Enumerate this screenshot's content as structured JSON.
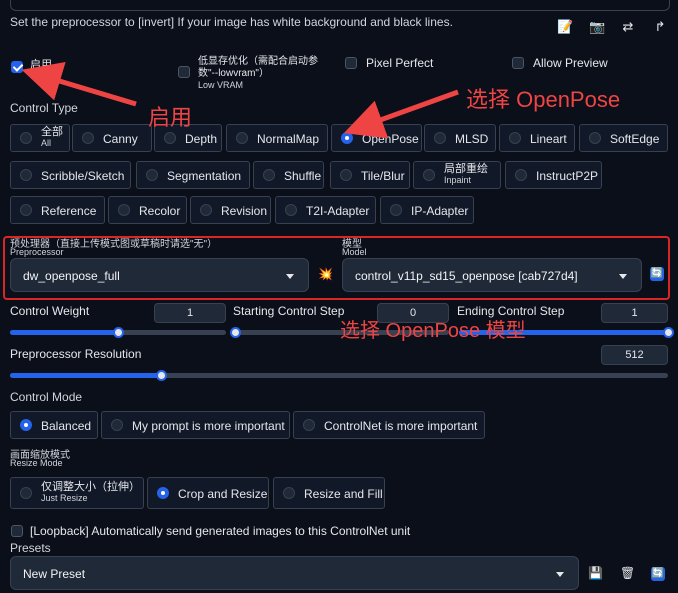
{
  "note": "Set the preprocessor to [invert] If your image has white background and black lines.",
  "toolbar_icons": [
    "edit-icon",
    "camera-icon",
    "swap-icon",
    "send-icon"
  ],
  "toolbar_glyphs": [
    "📝",
    "📷",
    "⇄",
    "↱"
  ],
  "options": {
    "enable_zh": "启用",
    "enable_en": "Enable",
    "enable_checked": true,
    "lowvram_zh": "低显存优化（需配合启动参数\"--lowvram\"）",
    "lowvram_en": "Low VRAM",
    "lowvram_checked": false,
    "pixel_perfect": "Pixel Perfect",
    "pixel_perfect_checked": false,
    "allow_preview": "Allow Preview",
    "allow_preview_checked": false
  },
  "control_type": {
    "label": "Control Type",
    "items": [
      "全部",
      "Canny",
      "Depth",
      "NormalMap",
      "OpenPose",
      "MLSD",
      "Lineart",
      "SoftEdge",
      "Scribble/Sketch",
      "Segmentation",
      "Shuffle",
      "Tile/Blur",
      "局部重绘",
      "InstructP2P",
      "Reference",
      "Recolor",
      "Revision",
      "T2I-Adapter",
      "IP-Adapter"
    ],
    "all_sub": "All",
    "inpaint_sub": "Inpaint",
    "selected": "OpenPose"
  },
  "preprocessor": {
    "label_zh": "预处理器（直接上传模式图或草稿时请选\"无\"）",
    "label_en": "Preprocessor",
    "value": "dw_openpose_full"
  },
  "explode_glyph": "💥",
  "model": {
    "label_zh": "模型",
    "label_en": "Model",
    "value": "control_v11p_sd15_openpose [cab727d4]"
  },
  "refresh_glyph": "🔄",
  "sliders": {
    "control_weight": {
      "label": "Control Weight",
      "value": "1",
      "fraction": 0.5
    },
    "starting_step": {
      "label": "Starting Control Step",
      "value": "0",
      "fraction": 0
    },
    "ending_step": {
      "label": "Ending Control Step",
      "value": "1",
      "fraction": 1
    },
    "preprocessor_resolution": {
      "label": "Preprocessor Resolution",
      "value": "512",
      "fraction": 0.23
    }
  },
  "control_mode": {
    "label": "Control Mode",
    "items": [
      "Balanced",
      "My prompt is more important",
      "ControlNet is more important"
    ],
    "selected": "Balanced"
  },
  "resize_mode": {
    "label_zh": "画面缩放模式",
    "label_en": "Resize Mode",
    "items": [
      "仅调整大小（拉伸）",
      "Crop and Resize",
      "Resize and Fill"
    ],
    "just_resize_sub": "Just Resize",
    "selected": "Crop and Resize"
  },
  "loopback": {
    "label": "[Loopback] Automatically send generated images to this ControlNet unit",
    "checked": false
  },
  "presets": {
    "label": "Presets",
    "value": "New Preset"
  },
  "preset_glyphs": [
    "💾",
    "🗑",
    "🔄"
  ],
  "annotations": {
    "enable": "启用",
    "select_openpose": "选择 OpenPose",
    "select_model": "选择 OpenPose 模型"
  },
  "colors": {
    "accent": "#2563eb",
    "annotation": "#ef4444",
    "background": "#0b0f19"
  }
}
